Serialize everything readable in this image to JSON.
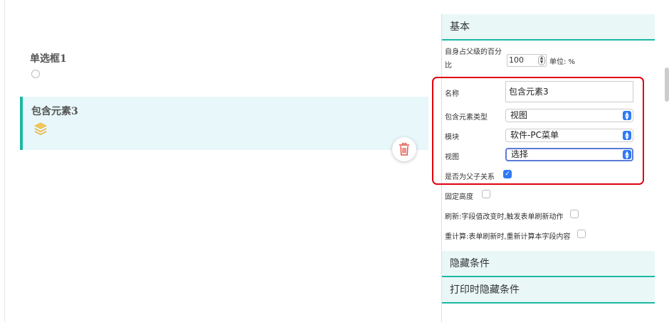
{
  "canvas": {
    "fields": [
      {
        "label": "单选框1",
        "type": "radio"
      },
      {
        "label": "包含元素3",
        "type": "include",
        "selected": true
      }
    ],
    "icons": {
      "radio": "radio-icon",
      "layers": "layers-icon",
      "delete": "trash-icon"
    },
    "accent_color": "#1bb8a4",
    "delete_color": "#e05a4f"
  },
  "panel": {
    "sections": {
      "basic": "基本",
      "hide_condition": "隐藏条件",
      "print_hide_condition": "打印时隐藏条件"
    },
    "percent": {
      "label": "自身占父级的百分比",
      "value": "100",
      "unit": "单位: %"
    },
    "name": {
      "label": "名称",
      "value": "包含元素3"
    },
    "include_type": {
      "label": "包含元素类型",
      "value": "视图"
    },
    "module": {
      "label": "模块",
      "value": "软件-PC菜单"
    },
    "view": {
      "label": "视图",
      "value": "选择"
    },
    "parent_child": {
      "label": "是否为父子关系",
      "checked": true
    },
    "fixed_height": {
      "label": "固定高度",
      "checked": false
    },
    "refresh": {
      "label": "刷新:字段值改变时,触发表单刷新动作",
      "checked": false
    },
    "recalc": {
      "label": "重计算:表单刷新时,重新计算本字段内容",
      "checked": false
    },
    "highlight_color": "#e0000d",
    "select_arrow_color": "#2f7af5"
  }
}
